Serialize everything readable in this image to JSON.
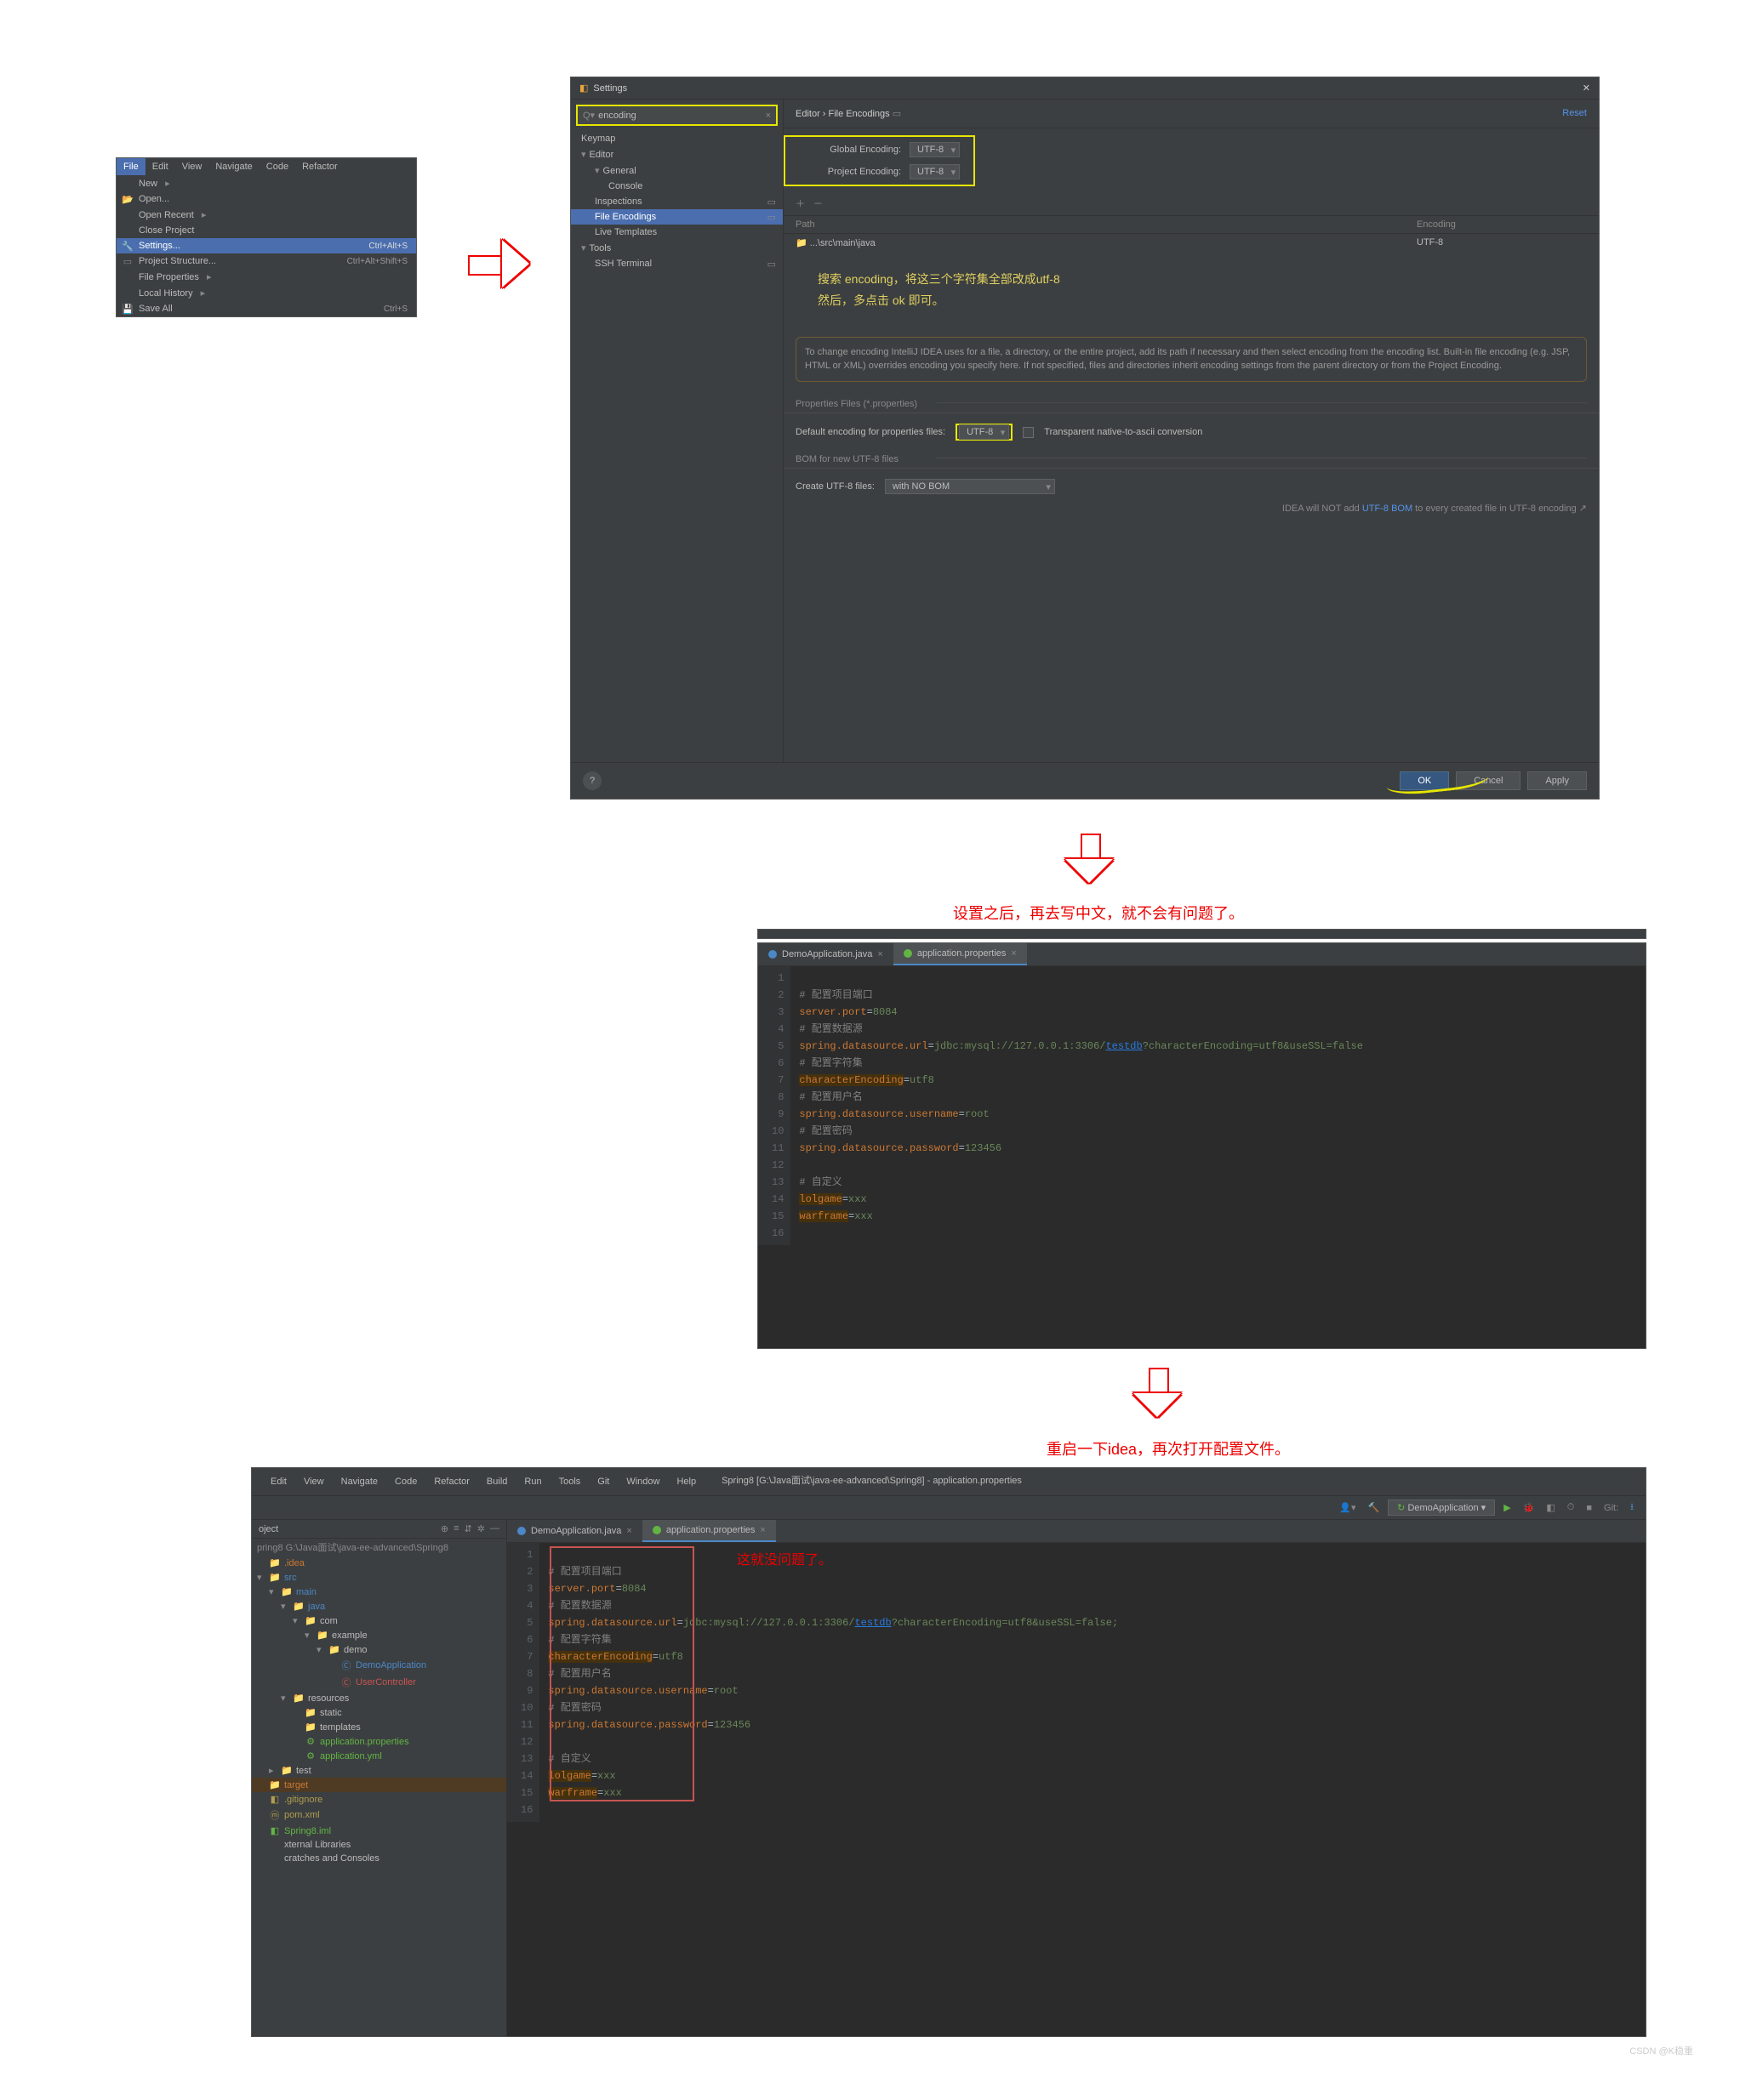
{
  "filemenu": {
    "menubar": [
      "File",
      "Edit",
      "View",
      "Navigate",
      "Code",
      "Refactor"
    ],
    "items": [
      {
        "label": "New",
        "icon": "",
        "arrow": true
      },
      {
        "label": "Open...",
        "icon": "📂"
      },
      {
        "label": "Open Recent",
        "arrow": true
      },
      {
        "label": "Close Project"
      },
      {
        "label": "Settings...",
        "icon": "🔧",
        "shortcut": "Ctrl+Alt+S",
        "selected": true
      },
      {
        "label": "Project Structure...",
        "icon": "▭",
        "shortcut": "Ctrl+Alt+Shift+S"
      },
      {
        "label": "File Properties",
        "arrow": true
      },
      {
        "label": "Local History",
        "arrow": true
      },
      {
        "label": "Save All",
        "icon": "💾",
        "shortcut": "Ctrl+S"
      }
    ]
  },
  "settings": {
    "title": "Settings",
    "search": "encoding",
    "tree": [
      {
        "label": "Keymap",
        "lvl": 1
      },
      {
        "label": "Editor",
        "lvl": 1,
        "exp": true
      },
      {
        "label": "General",
        "lvl": 2,
        "exp": true
      },
      {
        "label": "Console",
        "lvl": 3
      },
      {
        "label": "Inspections",
        "lvl": 2,
        "mark": "▭"
      },
      {
        "label": "File Encodings",
        "lvl": 2,
        "mark": "▭",
        "selected": true
      },
      {
        "label": "Live Templates",
        "lvl": 2
      },
      {
        "label": "Tools",
        "lvl": 1,
        "exp": true
      },
      {
        "label": "SSH Terminal",
        "lvl": 2,
        "mark": "▭"
      }
    ],
    "breadcrumb": "Editor  ›  File Encodings",
    "reset": "Reset",
    "global_label": "Global Encoding:",
    "global_value": "UTF-8",
    "project_label": "Project Encoding:",
    "project_value": "UTF-8",
    "path_label": "Path",
    "enc_label": "Encoding",
    "row_path": "...\\src\\main\\java",
    "row_enc": "UTF-8",
    "anno1": "搜索 encoding，将这三个字符集全部改成utf-8",
    "anno2": "然后，多点击 ok 即可。",
    "infobox": "To change encoding IntelliJ IDEA uses for a file, a directory, or the entire project, add its path if necessary and then select encoding from the encoding list. Built-in file encoding (e.g. JSP, HTML or XML) overrides encoding you specify here. If not specified, files and directories inherit encoding settings from the parent directory or from the Project Encoding.",
    "props_section": "Properties Files (*.properties)",
    "props_label": "Default encoding for properties files:",
    "props_value": "UTF-8",
    "transparent": "Transparent native-to-ascii conversion",
    "bom_section": "BOM for new UTF-8 files",
    "bom_label": "Create UTF-8 files:",
    "bom_value": "with NO BOM",
    "bom_note_pre": "IDEA will NOT add ",
    "bom_note_link": "UTF-8 BOM",
    "bom_note_post": " to every created file in UTF-8 encoding",
    "ok": "OK",
    "cancel": "Cancel",
    "apply": "Apply"
  },
  "caption1": "设置之后，再去写中文，就不会有问题了。",
  "caption2": "重启一下idea，再次打开配置文件。",
  "caption3": "这就没问题了。",
  "editor1": {
    "tabs": [
      {
        "label": "DemoApplication.java",
        "color": "blue"
      },
      {
        "label": "application.properties",
        "color": "green",
        "active": true
      }
    ],
    "lines": [
      {
        "n": 1,
        "t": ""
      },
      {
        "n": 2,
        "t": "# 配置项目端口",
        "cls": "c-comment"
      },
      {
        "n": 3,
        "k": "server.port",
        "v": "8084"
      },
      {
        "n": 4,
        "t": "# 配置数据源",
        "cls": "c-comment"
      },
      {
        "n": 5,
        "k": "spring.datasource.url",
        "v": "jdbc:mysql://127.0.0.1:3306/",
        "link": "testdb",
        "v2": "?characterEncoding=utf8&useSSL=false"
      },
      {
        "n": 6,
        "t": "# 配置字符集",
        "cls": "c-comment"
      },
      {
        "n": 7,
        "k": "characterEncoding",
        "v": "utf8",
        "hl": true
      },
      {
        "n": 8,
        "t": "# 配置用户名",
        "cls": "c-comment"
      },
      {
        "n": 9,
        "k": "spring.datasource.username",
        "v": "root"
      },
      {
        "n": 10,
        "t": "# 配置密码",
        "cls": "c-comment"
      },
      {
        "n": 11,
        "k": "spring.datasource.password",
        "v": "123456"
      },
      {
        "n": 12,
        "t": ""
      },
      {
        "n": 13,
        "t": "# 自定义",
        "cls": "c-comment"
      },
      {
        "n": 14,
        "k": "lolgame",
        "v": "xxx",
        "hl": true
      },
      {
        "n": 15,
        "k": "warframe",
        "v": "xxx",
        "hl": true
      },
      {
        "n": 16,
        "t": ""
      }
    ]
  },
  "ide": {
    "menubar": [
      "Edit",
      "View",
      "Navigate",
      "Code",
      "Refactor",
      "Build",
      "Run",
      "Tools",
      "Git",
      "Window",
      "Help"
    ],
    "pathbar": "Spring8 [G:\\Java面试\\java-ee-advanced\\Spring8] - application.properties",
    "runcfg": "DemoApplication",
    "projhdr": "oject",
    "projpath": "pring8  G:\\Java面试\\java-ee-advanced\\Spring8",
    "tree": [
      {
        "lvl": 0,
        "car": "",
        "ico": "📁",
        "label": ".idea",
        "cls": "orange"
      },
      {
        "lvl": 0,
        "car": "▾",
        "ico": "📁",
        "label": "src",
        "cls": "blue"
      },
      {
        "lvl": 1,
        "car": "▾",
        "ico": "📁",
        "label": "main",
        "cls": "blue"
      },
      {
        "lvl": 2,
        "car": "▾",
        "ico": "📁",
        "label": "java",
        "cls": "blue"
      },
      {
        "lvl": 3,
        "car": "▾",
        "ico": "📁",
        "label": "com",
        "cls": ""
      },
      {
        "lvl": 4,
        "car": "▾",
        "ico": "📁",
        "label": "example",
        "cls": ""
      },
      {
        "lvl": 5,
        "car": "▾",
        "ico": "📁",
        "label": "demo",
        "cls": ""
      },
      {
        "lvl": 6,
        "car": "",
        "ico": "Ⓒ",
        "label": "DemoApplication",
        "cls": "blue"
      },
      {
        "lvl": 6,
        "car": "",
        "ico": "Ⓒ",
        "label": "UserController",
        "cls": "red"
      },
      {
        "lvl": 2,
        "car": "▾",
        "ico": "📁",
        "label": "resources",
        "cls": ""
      },
      {
        "lvl": 3,
        "car": "",
        "ico": "📁",
        "label": "static",
        "cls": ""
      },
      {
        "lvl": 3,
        "car": "",
        "ico": "📁",
        "label": "templates",
        "cls": ""
      },
      {
        "lvl": 3,
        "car": "",
        "ico": "⚙",
        "label": "application.properties",
        "cls": "green"
      },
      {
        "lvl": 3,
        "car": "",
        "ico": "⚙",
        "label": "application.yml",
        "cls": "green"
      },
      {
        "lvl": 1,
        "car": "▸",
        "ico": "📁",
        "label": "test",
        "cls": ""
      },
      {
        "lvl": 0,
        "car": "",
        "ico": "📁",
        "label": "target",
        "cls": "orange",
        "hl": true
      },
      {
        "lvl": 0,
        "car": "",
        "ico": "◧",
        "label": ".gitignore",
        "cls": "yel"
      },
      {
        "lvl": 0,
        "car": "",
        "ico": "ⓜ",
        "label": "pom.xml",
        "cls": "yel"
      },
      {
        "lvl": 0,
        "car": "",
        "ico": "◧",
        "label": "Spring8.iml",
        "cls": "green"
      },
      {
        "lvl": 0,
        "car": "",
        "ico": "",
        "label": "xternal Libraries",
        "cls": ""
      },
      {
        "lvl": 0,
        "car": "",
        "ico": "",
        "label": "cratches and Consoles",
        "cls": ""
      }
    ],
    "tabs": [
      {
        "label": "DemoApplication.java",
        "color": "blue"
      },
      {
        "label": "application.properties",
        "color": "green",
        "active": true
      }
    ],
    "lines": [
      {
        "n": 1,
        "t": ""
      },
      {
        "n": 2,
        "t": "# 配置项目端口",
        "cls": "c-comment"
      },
      {
        "n": 3,
        "k": "server.port",
        "v": "8084"
      },
      {
        "n": 4,
        "t": "# 配置数据源",
        "cls": "c-comment"
      },
      {
        "n": 5,
        "k": "spring.datasource.url",
        "v": "jdbc:mysql://127.0.0.1:3306/",
        "link": "testdb",
        "v2": "?characterEncoding=utf8&useSSL=false;"
      },
      {
        "n": 6,
        "t": "# 配置字符集",
        "cls": "c-comment"
      },
      {
        "n": 7,
        "k": "characterEncoding",
        "v": "utf8",
        "hl": true
      },
      {
        "n": 8,
        "t": "# 配置用户名",
        "cls": "c-comment"
      },
      {
        "n": 9,
        "k": "spring.datasource.username",
        "v": "root"
      },
      {
        "n": 10,
        "t": "# 配置密码",
        "cls": "c-comment"
      },
      {
        "n": 11,
        "k": "spring.datasource.password",
        "v": "123456"
      },
      {
        "n": 12,
        "t": ""
      },
      {
        "n": 13,
        "t": "# 自定义",
        "cls": "c-comment"
      },
      {
        "n": 14,
        "k": "lolgame",
        "v": "xxx",
        "hl": true
      },
      {
        "n": 15,
        "k": "warframe",
        "v": "xxx",
        "hl": true
      },
      {
        "n": 16,
        "t": ""
      }
    ]
  },
  "watermark": "CSDN @K稳重"
}
